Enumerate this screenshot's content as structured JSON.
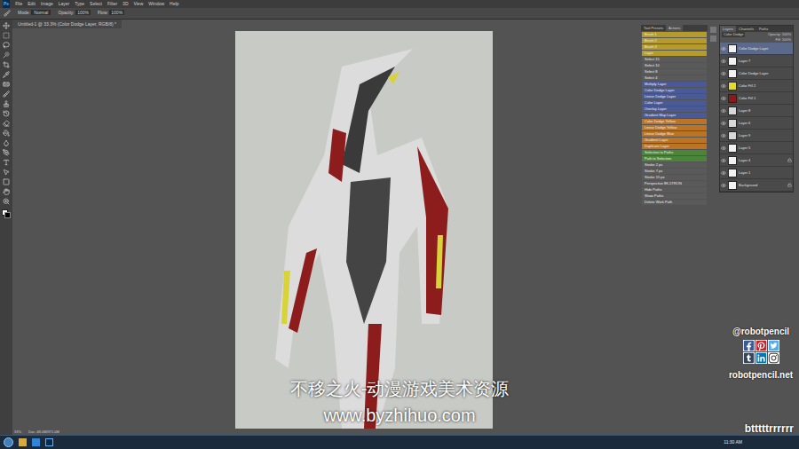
{
  "app": {
    "logo": "Ps",
    "menu": [
      "File",
      "Edit",
      "Image",
      "Layer",
      "Type",
      "Select",
      "Filter",
      "3D",
      "View",
      "Window",
      "Help"
    ]
  },
  "options_bar": {
    "mode_label": "Mode:",
    "mode": "Normal",
    "opacity_label": "Opacity:",
    "opacity": "100%",
    "flow_label": "Flow:",
    "flow": "100%"
  },
  "document": {
    "tab": "Untitled-1 @ 33.3% (Color Dodge Layer, RGB/8) *",
    "zoom": "33%",
    "doc_info": "Doc: 48.0M/371.0M"
  },
  "actions_panel": {
    "tabs": [
      {
        "label": "Tool Presets",
        "selected": false
      },
      {
        "label": "Actions",
        "selected": true
      }
    ],
    "actions": [
      {
        "label": "Brush 1",
        "color": "#b49b2c"
      },
      {
        "label": "Brush 2",
        "color": "#b49b2c"
      },
      {
        "label": "Brush 3",
        "color": "#b49b2c"
      },
      {
        "label": "Layer",
        "color": "#b49b2c"
      },
      {
        "label": "Select 15",
        "color": "#5a5a5a"
      },
      {
        "label": "Select 10",
        "color": "#5a5a5a"
      },
      {
        "label": "Select 8",
        "color": "#5a5a5a"
      },
      {
        "label": "Select 4",
        "color": "#5a5a5a"
      },
      {
        "label": "Multiply Layer",
        "color": "#4a5a96"
      },
      {
        "label": "Color Dodge Layer",
        "color": "#4a5a96"
      },
      {
        "label": "Linear Dodge Layer",
        "color": "#4a5a96"
      },
      {
        "label": "Color Layer",
        "color": "#4a5a96"
      },
      {
        "label": "Overlay Layer",
        "color": "#4a5a96"
      },
      {
        "label": "Gradient Map Layer",
        "color": "#4a5a96"
      },
      {
        "label": "Color Dodge Yellow",
        "color": "#bb7424"
      },
      {
        "label": "Linear Dodge Yellow",
        "color": "#bb7424"
      },
      {
        "label": "Linear Dodge Blue",
        "color": "#bb7424"
      },
      {
        "label": "Gradient Layer",
        "color": "#bb7424"
      },
      {
        "label": "Duplicate Layer",
        "color": "#bb7424"
      },
      {
        "label": "Selection to Paths",
        "color": "#4b853a"
      },
      {
        "label": "Path to Selection",
        "color": "#4b853a"
      },
      {
        "label": "Stroke 2 px",
        "color": "#5a5a5a"
      },
      {
        "label": "Stroke 7 px",
        "color": "#5a5a5a"
      },
      {
        "label": "Stroke 15 px",
        "color": "#5a5a5a"
      },
      {
        "label": "Perspective 8K-5TRON",
        "color": "#5a5a5a"
      },
      {
        "label": "Hide Paths",
        "color": "#5a5a5a"
      },
      {
        "label": "Show Paths",
        "color": "#5a5a5a"
      },
      {
        "label": "Delete Work Path",
        "color": "#5a5a5a"
      }
    ]
  },
  "layers_panel": {
    "tabs": [
      {
        "label": "Layers",
        "selected": true
      },
      {
        "label": "Channels",
        "selected": false
      },
      {
        "label": "Paths",
        "selected": false
      }
    ],
    "blend_mode": "Color Dodge",
    "opacity_label": "Opacity:",
    "opacity": "100%",
    "fill_label": "Fill:",
    "fill": "100%",
    "layers": [
      {
        "name": "Color Dodge Layer",
        "selected": true,
        "locked": false,
        "color": "#f2f2f2"
      },
      {
        "name": "Layer 7",
        "selected": false,
        "locked": false,
        "color": "#f2f2f2"
      },
      {
        "name": "Color Dodge Layer",
        "selected": false,
        "locked": false,
        "color": "#f2f2f2"
      },
      {
        "name": "Color Fill 2",
        "selected": false,
        "locked": false,
        "color": "#e3dc2c"
      },
      {
        "name": "Color Fill 1",
        "selected": false,
        "locked": false,
        "color": "#8a1a1a"
      },
      {
        "name": "Layer 8",
        "selected": false,
        "locked": false,
        "color": "#d8d8d8"
      },
      {
        "name": "Layer 6",
        "selected": false,
        "locked": false,
        "color": "#d8d8d8"
      },
      {
        "name": "Layer 9",
        "selected": false,
        "locked": false,
        "color": "#d8d8d8"
      },
      {
        "name": "Layer 5",
        "selected": false,
        "locked": false,
        "color": "#f2f2f2"
      },
      {
        "name": "Layer 4",
        "selected": false,
        "locked": true,
        "color": "#f2f2f2"
      },
      {
        "name": "Layer 1",
        "selected": false,
        "locked": false,
        "color": "#f2f2f2"
      },
      {
        "name": "Background",
        "selected": false,
        "locked": true,
        "color": "#f2f2f2"
      }
    ]
  },
  "watermark": {
    "line1": "不移之火-动漫游戏美术资源",
    "line2": "www.byzhihuo.com"
  },
  "credits": {
    "handle": "@robotpencil",
    "site": "robotpencil.net",
    "caption": "btttttrrrrrr"
  },
  "taskbar": {
    "time": "11:30 AM"
  }
}
